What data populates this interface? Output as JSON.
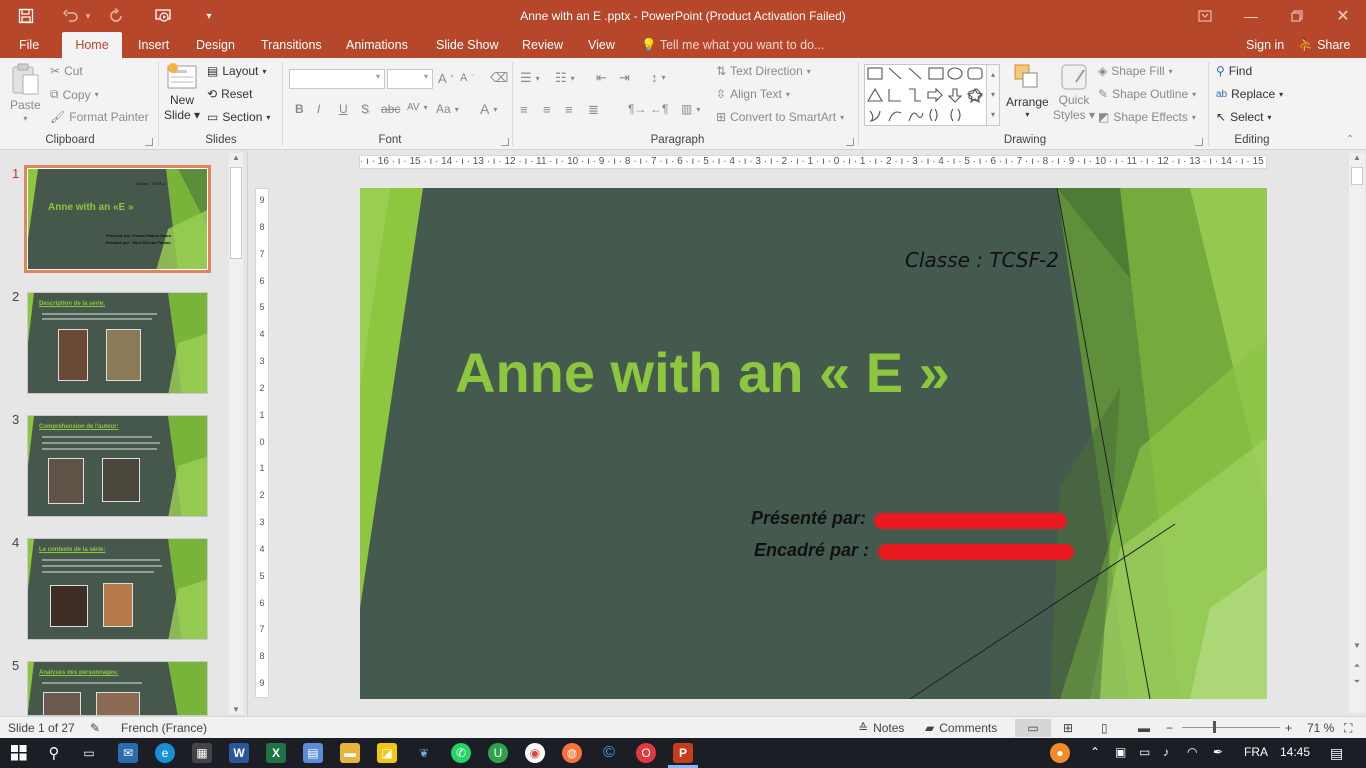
{
  "window": {
    "title": "Anne with an E .pptx - PowerPoint (Product Activation Failed)"
  },
  "tabs": {
    "file": "File",
    "home": "Home",
    "insert": "Insert",
    "design": "Design",
    "transitions": "Transitions",
    "animations": "Animations",
    "slideshow": "Slide Show",
    "review": "Review",
    "view": "View",
    "tellme": "Tell me what you want to do...",
    "signin": "Sign in",
    "share": "Share"
  },
  "ribbon": {
    "clipboard": {
      "paste": "Paste",
      "cut": "Cut",
      "copy": "Copy",
      "format_painter": "Format Painter",
      "group": "Clipboard"
    },
    "slides": {
      "new_slide_1": "New",
      "new_slide_2": "Slide",
      "layout": "Layout",
      "reset": "Reset",
      "section": "Section",
      "group": "Slides"
    },
    "font": {
      "group": "Font",
      "bold": "B",
      "italic": "I",
      "underline": "U",
      "shadow": "S",
      "spacing": "AV",
      "case": "Aa",
      "color": "A",
      "grow": "A",
      "shrink": "A"
    },
    "paragraph": {
      "group": "Paragraph",
      "text_direction": "Text Direction",
      "align_text": "Align Text",
      "smartart": "Convert to SmartArt"
    },
    "drawing": {
      "group": "Drawing",
      "arrange": "Arrange",
      "quick_styles_1": "Quick",
      "quick_styles_2": "Styles",
      "shape_fill": "Shape Fill",
      "shape_outline": "Shape Outline",
      "shape_effects": "Shape Effects"
    },
    "editing": {
      "group": "Editing",
      "find": "Find",
      "replace": "Replace",
      "select": "Select"
    }
  },
  "thumbnails": [
    {
      "num": "1",
      "title": "Anne with an «E »"
    },
    {
      "num": "2",
      "title": "Description de la série:"
    },
    {
      "num": "3",
      "title": "Compréhension de l'auteur:"
    },
    {
      "num": "4",
      "title": "Le contexte de la série:"
    },
    {
      "num": "5",
      "title": "Analyses des personnages:"
    }
  ],
  "thumb1": {
    "classe": "Classe : TCSF-2",
    "presented": "Présenté par: Hanna Fatima Zahra",
    "framed": "Encadré par : Mme Bercad Fatima"
  },
  "ruler": {
    "h": "· ı · 16 · ı · 15 · ı · 14 · ı · 13 · ı · 12 · ı · 11 · ı · 10 · ı · 9 · ı · 8 · ı · 7 · ı · 6 · ı · 5 · ı · 4 · ı · 3 · ı · 2 · ı · 1 · ı · 0 · ı · 1 · ı · 2 · ı · 3 · ı · 4 · ı · 5 · ı · 6 · ı · 7 · ı · 8 · ı · 9 · ı · 10 · ı · 11 · ı · 12 · ı · 13 · ı · 14 · ı · 15 · ı · 16 · ı ·",
    "v": [
      "9",
      "8",
      "7",
      "6",
      "5",
      "4",
      "3",
      "2",
      "1",
      "0",
      "1",
      "2",
      "3",
      "4",
      "5",
      "6",
      "7",
      "8",
      "9"
    ]
  },
  "slide": {
    "classe": "Classe : TCSF-2",
    "title": "Anne with an « E »",
    "presented": "Présenté par:",
    "framed": "Encadré par :"
  },
  "status": {
    "slide": "Slide 1 of 27",
    "language": "French (France)",
    "notes": "Notes",
    "comments": "Comments",
    "zoom": "71 %"
  },
  "taskbar": {
    "lang": "FRA",
    "time": "14:45"
  },
  "colors": {
    "accent": "#b7472a",
    "slide_bg": "#455a4e",
    "green": "#8dc63f",
    "redaction": "#e8191f"
  }
}
